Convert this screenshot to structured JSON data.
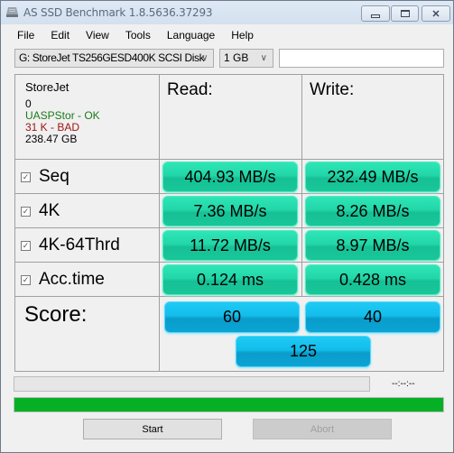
{
  "window": {
    "title": "AS SSD Benchmark 1.8.5636.37293",
    "controls": {
      "minimize": "▭",
      "maximize": "▣",
      "close": "✕"
    }
  },
  "menu": [
    "File",
    "Edit",
    "View",
    "Tools",
    "Language",
    "Help"
  ],
  "toolbar": {
    "disk_select": "G: StoreJet TS256GESD400K SCSI Disk",
    "size_select": "1 GB",
    "text_input_value": ""
  },
  "drive_info": {
    "name": "StoreJet",
    "line2": "0",
    "driver": "UASPStor - OK",
    "alignment": "31 K - BAD",
    "capacity": "238.47 GB"
  },
  "headers": {
    "read": "Read:",
    "write": "Write:"
  },
  "tests": [
    {
      "label": "Seq",
      "checked": true,
      "read": "404.93 MB/s",
      "write": "232.49 MB/s"
    },
    {
      "label": "4K",
      "checked": true,
      "read": "7.36 MB/s",
      "write": "8.26 MB/s"
    },
    {
      "label": "4K-64Thrd",
      "checked": true,
      "read": "11.72 MB/s",
      "write": "8.97 MB/s"
    },
    {
      "label": "Acc.time",
      "checked": true,
      "read": "0.124 ms",
      "write": "0.428 ms"
    }
  ],
  "score": {
    "label": "Score:",
    "read": "60",
    "write": "40",
    "total": "125"
  },
  "status": {
    "time": "--:--:--",
    "test_progress_percent": 0,
    "overall_progress_percent": 100
  },
  "buttons": {
    "start": "Start",
    "abort": "Abort"
  },
  "colors": {
    "result_green": "#22d6a8",
    "score_blue": "#13bdea",
    "progress_green": "#06b025",
    "ok_text": "#1a7a1a",
    "bad_text": "#a01515"
  }
}
